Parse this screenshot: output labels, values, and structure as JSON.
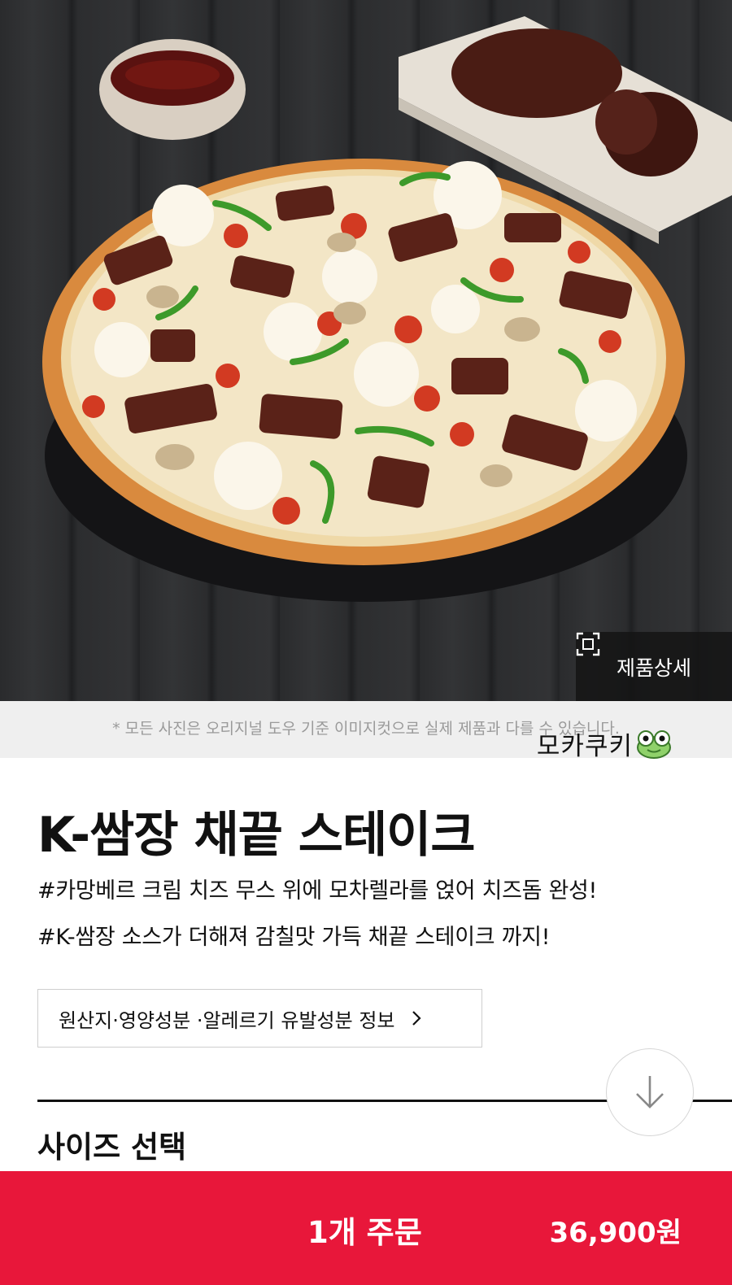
{
  "hero": {
    "image_label": "pizza-with-steak-photo",
    "detail_button_label": "제품상세"
  },
  "notice": {
    "text": "* 모든 사진은 오리지널 도우 기준 이미지컷으로 실제 제품과 다를 수 있습니다.",
    "watermark": "모카쿠키"
  },
  "product": {
    "name": "K-쌈장 채끝 스테이크",
    "description_lines": [
      "#카망베르 크림 치즈 무스 위에 모차렐라를 얹어 치즈돔 완성!",
      "#K-쌈장 소스가 더해져 감칠맛 가득 채끝 스테이크 까지!"
    ],
    "info_button_label": "원산지·영양성분 ·알레르기 유발성분 정보"
  },
  "size_section": {
    "title": "사이즈 선택"
  },
  "order_bar": {
    "label": "1개 주문",
    "price": "36,900원"
  },
  "colors": {
    "accent": "#e8173a",
    "notice_bg": "#efefef"
  },
  "icons": {
    "detail": "expand-frame-icon",
    "info_chevron": "chevron-right-icon",
    "scroll": "arrow-down-icon",
    "watermark": "frog-icon"
  }
}
